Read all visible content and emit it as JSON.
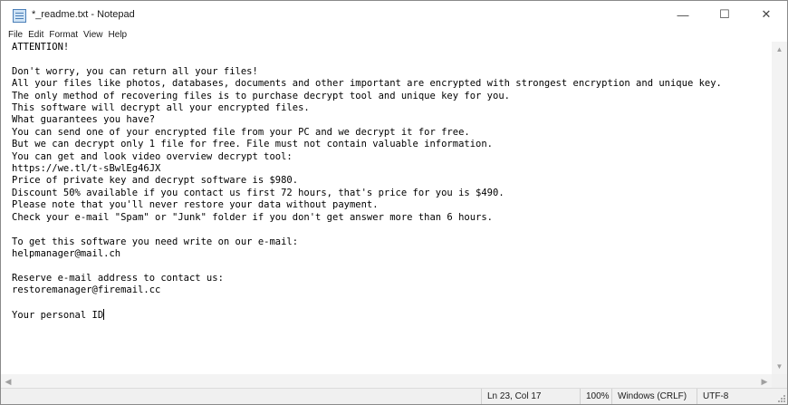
{
  "window": {
    "title": "*_readme.txt - Notepad",
    "controls": {
      "minimize": "—",
      "maximize": "☐",
      "close": "✕"
    }
  },
  "icons": {
    "app": "notepad-icon"
  },
  "menu": {
    "items": [
      "File",
      "Edit",
      "Format",
      "View",
      "Help"
    ]
  },
  "document": {
    "text": "ATTENTION!\n\nDon't worry, you can return all your files!\nAll your files like photos, databases, documents and other important are encrypted with strongest encryption and unique key.\nThe only method of recovering files is to purchase decrypt tool and unique key for you.\nThis software will decrypt all your encrypted files.\nWhat guarantees you have?\nYou can send one of your encrypted file from your PC and we decrypt it for free.\nBut we can decrypt only 1 file for free. File must not contain valuable information.\nYou can get and look video overview decrypt tool:\nhttps://we.tl/t-sBwlEg46JX\nPrice of private key and decrypt software is $980.\nDiscount 50% available if you contact us first 72 hours, that's price for you is $490.\nPlease note that you'll never restore your data without payment.\nCheck your e-mail \"Spam\" or \"Junk\" folder if you don't get answer more than 6 hours.\n\nTo get this software you need write on our e-mail:\nhelpmanager@mail.ch\n\nReserve e-mail address to contact us:\nrestoremanager@firemail.cc\n\nYour personal ID"
  },
  "status": {
    "position": "Ln 23, Col 17",
    "zoom": "100%",
    "line_ending": "Windows (CRLF)",
    "encoding": "UTF-8"
  }
}
